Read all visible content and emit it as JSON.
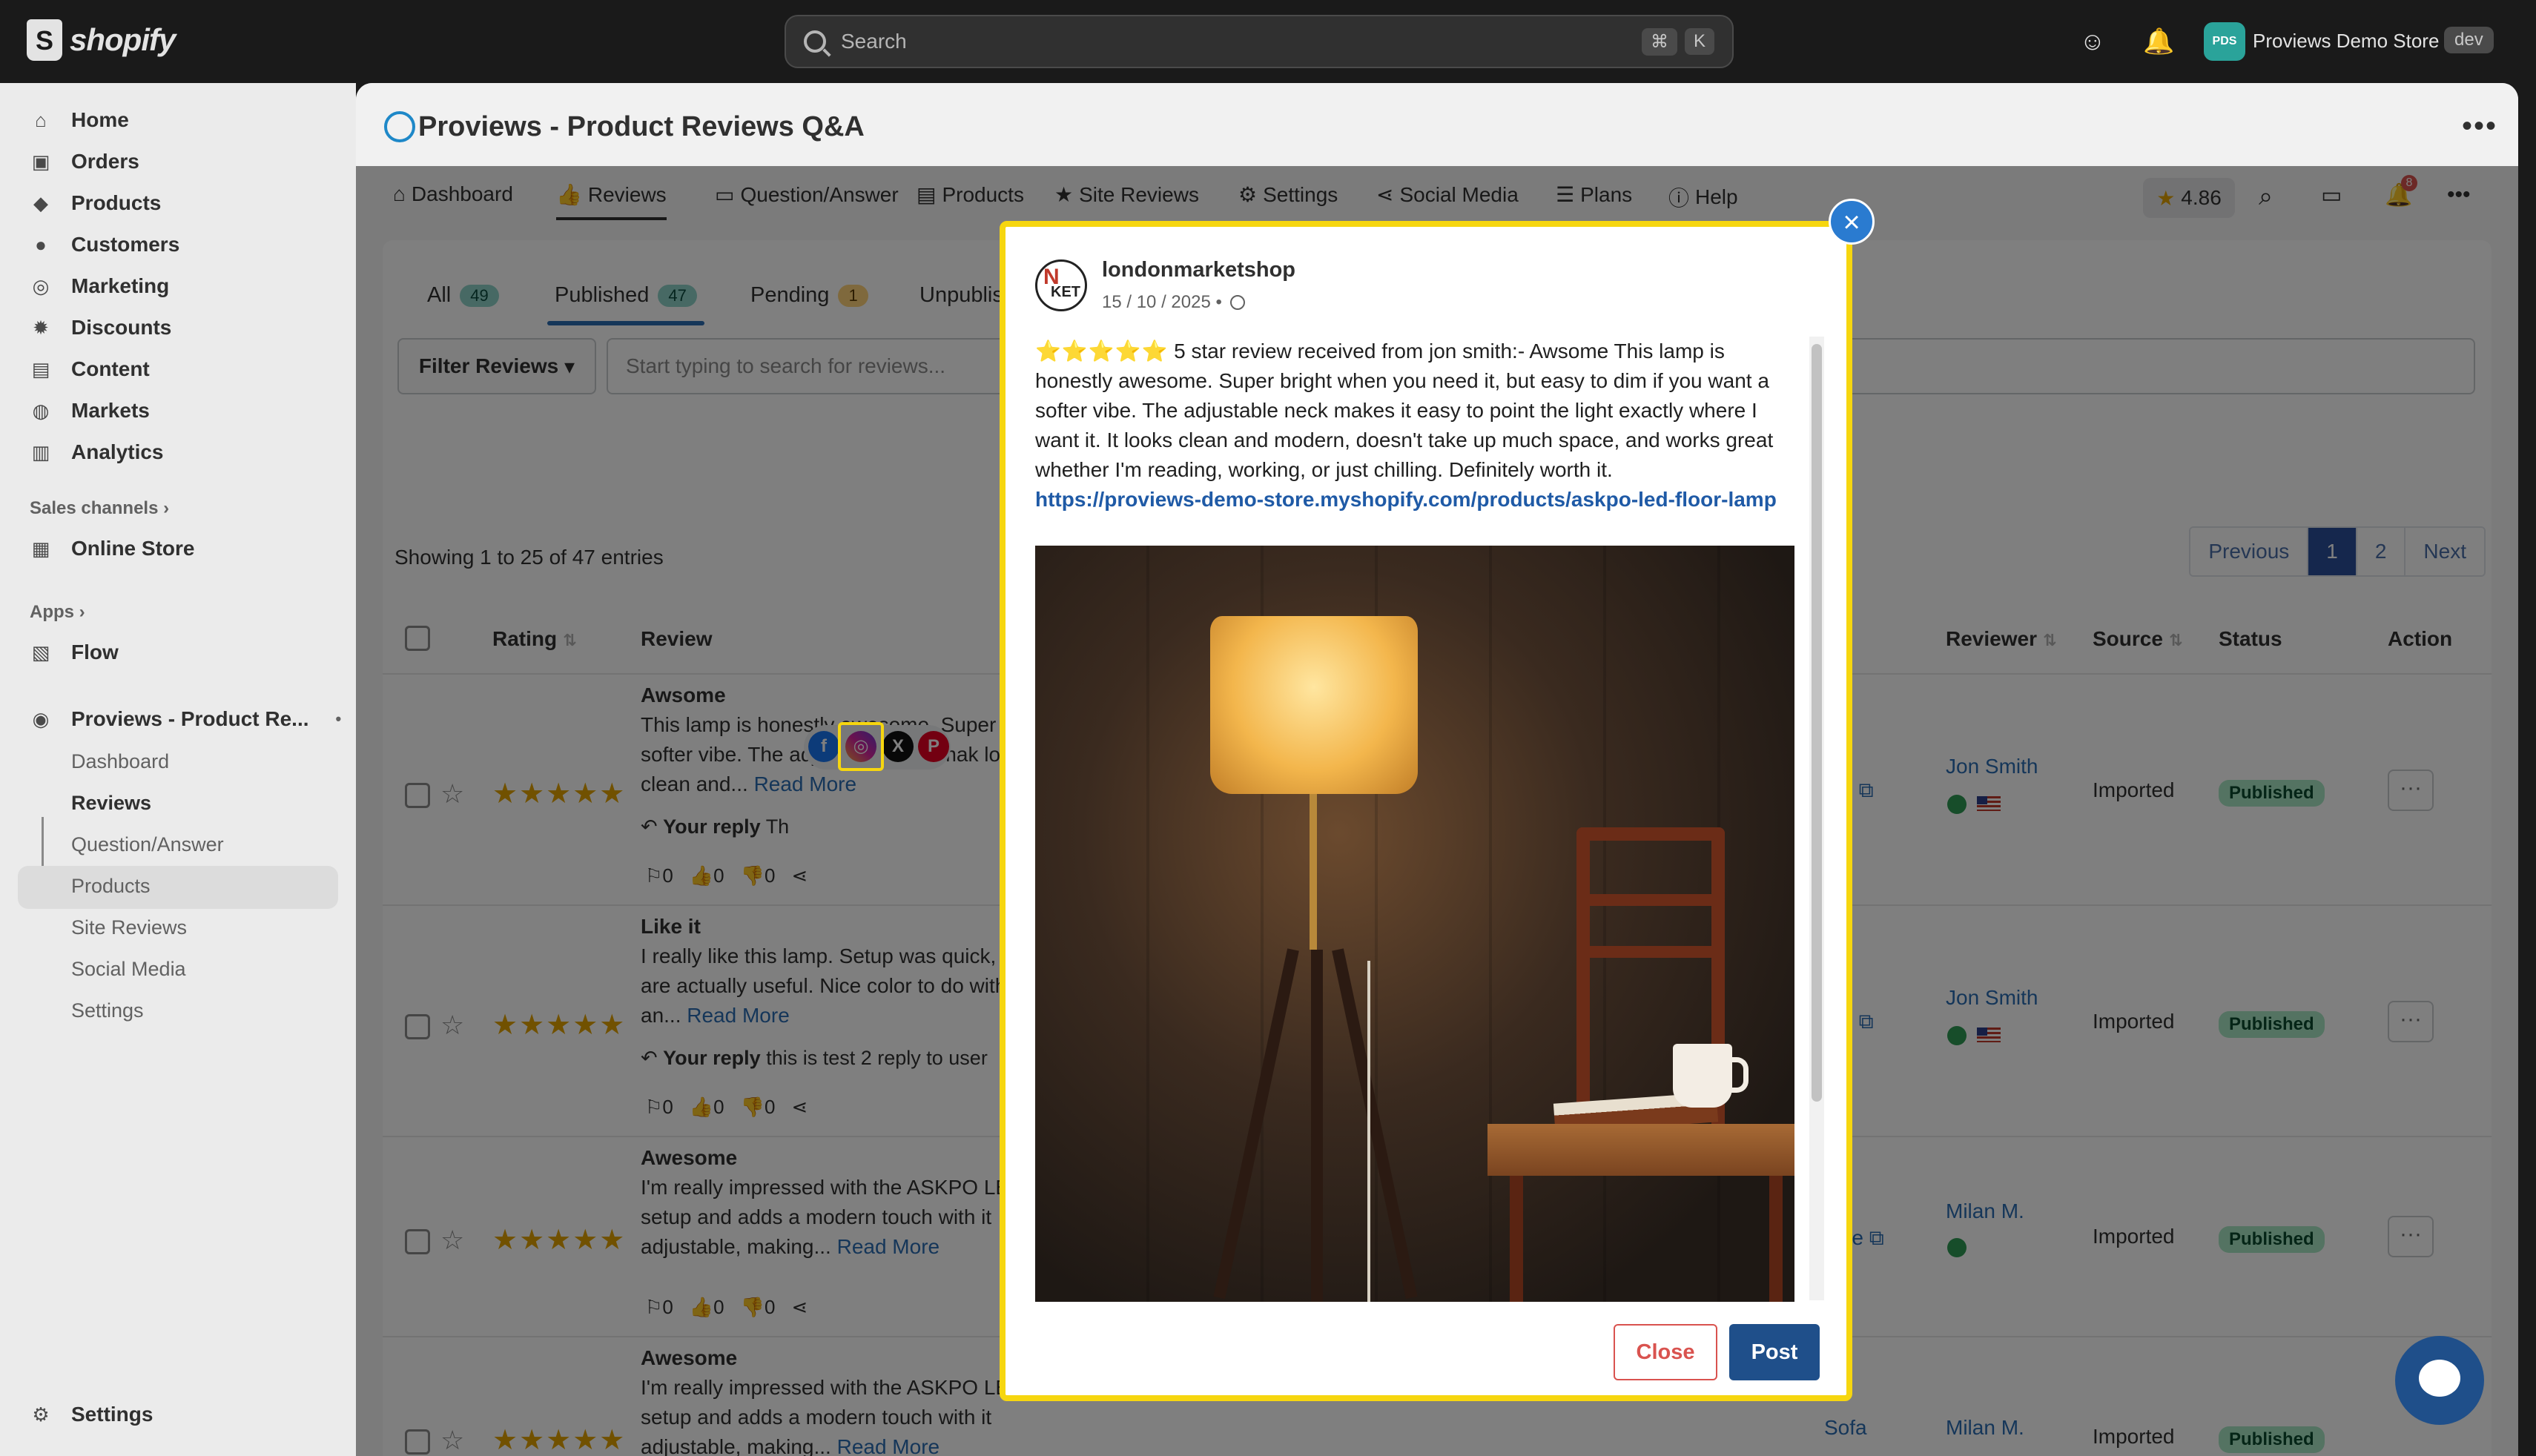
{
  "topbar": {
    "brand": "shopify",
    "search_placeholder": "Search",
    "shortcut_key1": "⌘",
    "shortcut_key2": "K",
    "store_initials": "PDS",
    "store_name": "Proviews Demo Store",
    "store_env": "dev"
  },
  "sidebar": {
    "items": [
      {
        "label": "Home",
        "icon": "home-icon"
      },
      {
        "label": "Orders",
        "icon": "orders-icon"
      },
      {
        "label": "Products",
        "icon": "tag-icon"
      },
      {
        "label": "Customers",
        "icon": "person-icon"
      },
      {
        "label": "Marketing",
        "icon": "target-icon"
      },
      {
        "label": "Discounts",
        "icon": "discount-icon"
      },
      {
        "label": "Content",
        "icon": "content-icon"
      },
      {
        "label": "Markets",
        "icon": "globe-icon"
      },
      {
        "label": "Analytics",
        "icon": "bar-chart-icon"
      }
    ],
    "sales_channels_label": "Sales channels",
    "online_store": "Online Store",
    "apps_label": "Apps",
    "flow": "Flow",
    "app_name": "Proviews - Product Re...",
    "app_subitems": [
      "Dashboard",
      "Reviews",
      "Question/Answer",
      "Products",
      "Site Reviews",
      "Social Media",
      "Settings"
    ],
    "settings": "Settings"
  },
  "app": {
    "title": "Proviews - Product Reviews Q&A",
    "tabs": [
      "Dashboard",
      "Reviews",
      "Question/Answer",
      "Products",
      "Site Reviews",
      "Settings",
      "Social Media",
      "Plans",
      "Help"
    ],
    "rating": "4.86",
    "notif_count": "8"
  },
  "reviews": {
    "filter_tabs": [
      {
        "label": "All",
        "count": "49"
      },
      {
        "label": "Published",
        "count": "47"
      },
      {
        "label": "Pending",
        "count": "1"
      },
      {
        "label": "Unpublis",
        "count": ""
      }
    ],
    "filter_button": "Filter Reviews",
    "search_placeholder": "Start typing to search for reviews...",
    "showing": "Showing 1 to 25 of 47 entries",
    "pager": [
      "Previous",
      "1",
      "2",
      "Next"
    ],
    "columns": {
      "rating": "Rating",
      "review": "Review",
      "reviewer": "Reviewer",
      "source": "Source",
      "status": "Status",
      "action": "Action"
    },
    "read_more": "Read More",
    "rows": [
      {
        "title": "Awsome",
        "body": "This lamp is honestly awesome. Super a softer vibe. The adjustable neck mak looks clean and...",
        "reply_label": "Your reply",
        "reply_text": "Th",
        "product_link": "mp",
        "reviewer": "Jon Smith",
        "source": "Imported",
        "status": "Published",
        "votes": [
          "0",
          "0",
          "0"
        ]
      },
      {
        "title": "Like it",
        "body": "I really like this lamp. Setup was quick, levels are actually useful. Nice color to do without an...",
        "reply_label": "Your reply",
        "reply_text": "this is test 2 reply to user",
        "product_link": "mp",
        "reviewer": "Jon Smith",
        "source": "Imported",
        "status": "Published",
        "votes": [
          "0",
          "0",
          "0"
        ]
      },
      {
        "title": "Awesome",
        "body": "I'm really impressed with the ASKPO LE setup and adds a modern touch with it adjustable, making...",
        "reply_label": "",
        "reply_text": "",
        "product_link": "able",
        "reviewer": "Milan M.",
        "source": "Imported",
        "status": "Published",
        "votes": [
          "0",
          "0",
          "0"
        ]
      },
      {
        "title": "Awesome",
        "body": "I'm really impressed with the ASKPO LE setup and adds a modern touch with it adjustable, making...",
        "reply_label": "",
        "reply_text": "",
        "product_link": "Sofa",
        "reviewer": "Milan M.",
        "source": "Imported",
        "status": "Published",
        "votes": [
          "0",
          "0",
          "0"
        ]
      }
    ],
    "share": {
      "facebook": "f",
      "instagram": "◎",
      "x": "X",
      "pinterest": "P"
    }
  },
  "modal": {
    "shop_name": "londonmarketshop",
    "date": "15 / 10 / 2025 •",
    "stars": "⭐⭐⭐⭐⭐",
    "text": " 5 star review received from jon smith:- Awsome This lamp is honestly awesome. Super bright when you need it, but easy to dim if you want a softer vibe. The adjustable neck makes it easy to point the light exactly where I want it. It looks clean and modern, doesn't take up much space, and works great whether I'm reading, working, or just chilling. Definitely worth it.",
    "link": "https://proviews-demo-store.myshopify.com/products/askpo-led-floor-lamp",
    "close_button": "Close",
    "post_button": "Post",
    "close_x": "×"
  }
}
